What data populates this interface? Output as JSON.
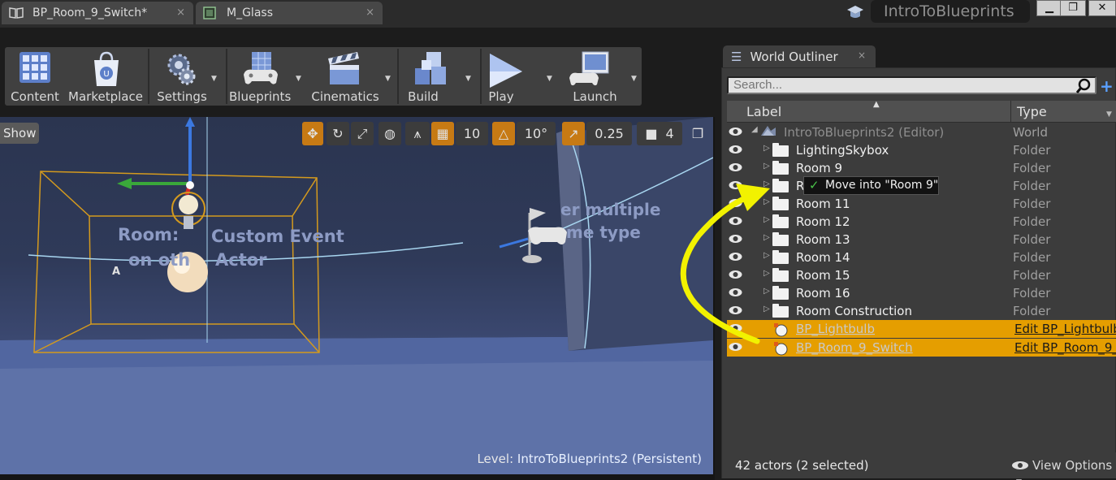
{
  "tabs": [
    {
      "label": "BP_Room_9_Switch*",
      "icon": "blueprint-book-icon",
      "close": "×"
    },
    {
      "label": "M_Glass",
      "icon": "material-icon",
      "close": "×"
    }
  ],
  "project_name": "IntroToBlueprints",
  "window_controls": {
    "minimize": "▁",
    "restore": "❐",
    "close": "✕"
  },
  "toolbar": [
    {
      "label": "Content",
      "icon": "content-browser-icon"
    },
    {
      "label": "Marketplace",
      "icon": "marketplace-bag-icon"
    },
    {
      "label": "Settings",
      "icon": "settings-gears-icon"
    },
    {
      "label": "Blueprints",
      "icon": "blueprints-gamepad-icon"
    },
    {
      "label": "Cinematics",
      "icon": "clapperboard-icon"
    },
    {
      "label": "Build",
      "icon": "build-cubes-icon"
    },
    {
      "label": "Play",
      "icon": "play-triangle-icon"
    },
    {
      "label": "Launch",
      "icon": "launch-monitor-icon"
    }
  ],
  "viewport": {
    "show_label": "Show",
    "grid_snap": "10",
    "rotation_snap": "10°",
    "scale_snap": "0.25",
    "camera_speed": "4",
    "level_prefix": "Level:",
    "level_name": "IntroToBlueprints2 (Persistent)",
    "scene_text_1": "Room:",
    "scene_text_2": "Custom Event",
    "scene_text_3": "on oth",
    "scene_text_4": "Actor",
    "scene_text_5": "er multiple",
    "scene_text_6": "me type",
    "scene_text_7": "A"
  },
  "outliner": {
    "tab_title": "World Outliner",
    "tab_close": "×",
    "search_placeholder": "Search...",
    "col_label": "Label",
    "col_type": "Type",
    "rows": [
      {
        "label": "IntroToBlueprints2 (Editor)",
        "type": "World"
      },
      {
        "label": "LightingSkybox",
        "type": "Folder"
      },
      {
        "label": "Room 9",
        "type": "Folder"
      },
      {
        "label": "R",
        "type": "Folder"
      },
      {
        "label": "Room 11",
        "type": "Folder"
      },
      {
        "label": "Room 12",
        "type": "Folder"
      },
      {
        "label": "Room 13",
        "type": "Folder"
      },
      {
        "label": "Room 14",
        "type": "Folder"
      },
      {
        "label": "Room 15",
        "type": "Folder"
      },
      {
        "label": "Room 16",
        "type": "Folder"
      },
      {
        "label": "Room Construction",
        "type": "Folder"
      },
      {
        "label": "BP_Lightbulb",
        "type": "Edit BP_Lightbulb"
      },
      {
        "label": "BP_Room_9_Switch",
        "type": "Edit BP_Room_9_"
      }
    ],
    "tooltip": "Move into \"Room 9\"",
    "tooltip_check": "✓",
    "actor_count": "42 actors (2 selected)",
    "view_options": "View Options"
  },
  "colors": {
    "selection": "#e59e00",
    "annotation_arrow": "#f2f200",
    "tool_orange": "#c77a14"
  }
}
